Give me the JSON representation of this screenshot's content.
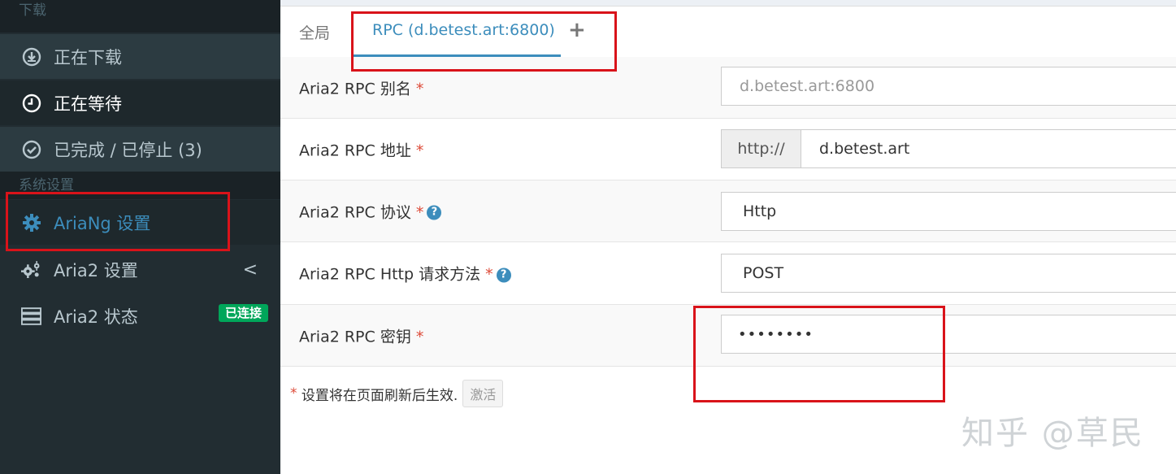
{
  "sidebar": {
    "header_download": "下载",
    "items": [
      {
        "label": "正在下载",
        "icon": "download-circle-icon"
      },
      {
        "label": "正在等待",
        "icon": "clock-icon"
      },
      {
        "label": "已完成 / 已停止 (3)",
        "icon": "check-circle-icon"
      }
    ],
    "header_settings": "系统设置",
    "settings": [
      {
        "label": "AriaNg 设置",
        "icon": "gear-icon"
      },
      {
        "label": "Aria2 设置",
        "icon": "gears-icon",
        "chevron": "<"
      },
      {
        "label": "Aria2 状态",
        "icon": "server-icon",
        "badge": "已连接"
      }
    ]
  },
  "tabs": {
    "global": "全局",
    "rpc": "RPC (d.betest.art:6800)",
    "add": "+"
  },
  "form": {
    "alias_label": "Aria2 RPC 别名",
    "alias_placeholder": "d.betest.art:6800",
    "address_label": "Aria2 RPC 地址",
    "address_prefix": "http://",
    "address_value": "d.betest.art",
    "protocol_label": "Aria2 RPC 协议",
    "protocol_value": "Http",
    "method_label": "Aria2 RPC Http 请求方法",
    "method_value": "POST",
    "secret_label": "Aria2 RPC 密钥",
    "secret_value": "••••••••",
    "required_mark": "*",
    "help_mark": "?"
  },
  "footer": {
    "note": "设置将在页面刷新后生效.",
    "activate_button": "激活"
  },
  "watermark": "知乎 @草民",
  "colors": {
    "sidebar_bg": "#222d32",
    "accent": "#3c8dbc",
    "badge_green": "#00a65a",
    "highlight_red": "#d9131a",
    "required_red": "#dd4b39"
  }
}
